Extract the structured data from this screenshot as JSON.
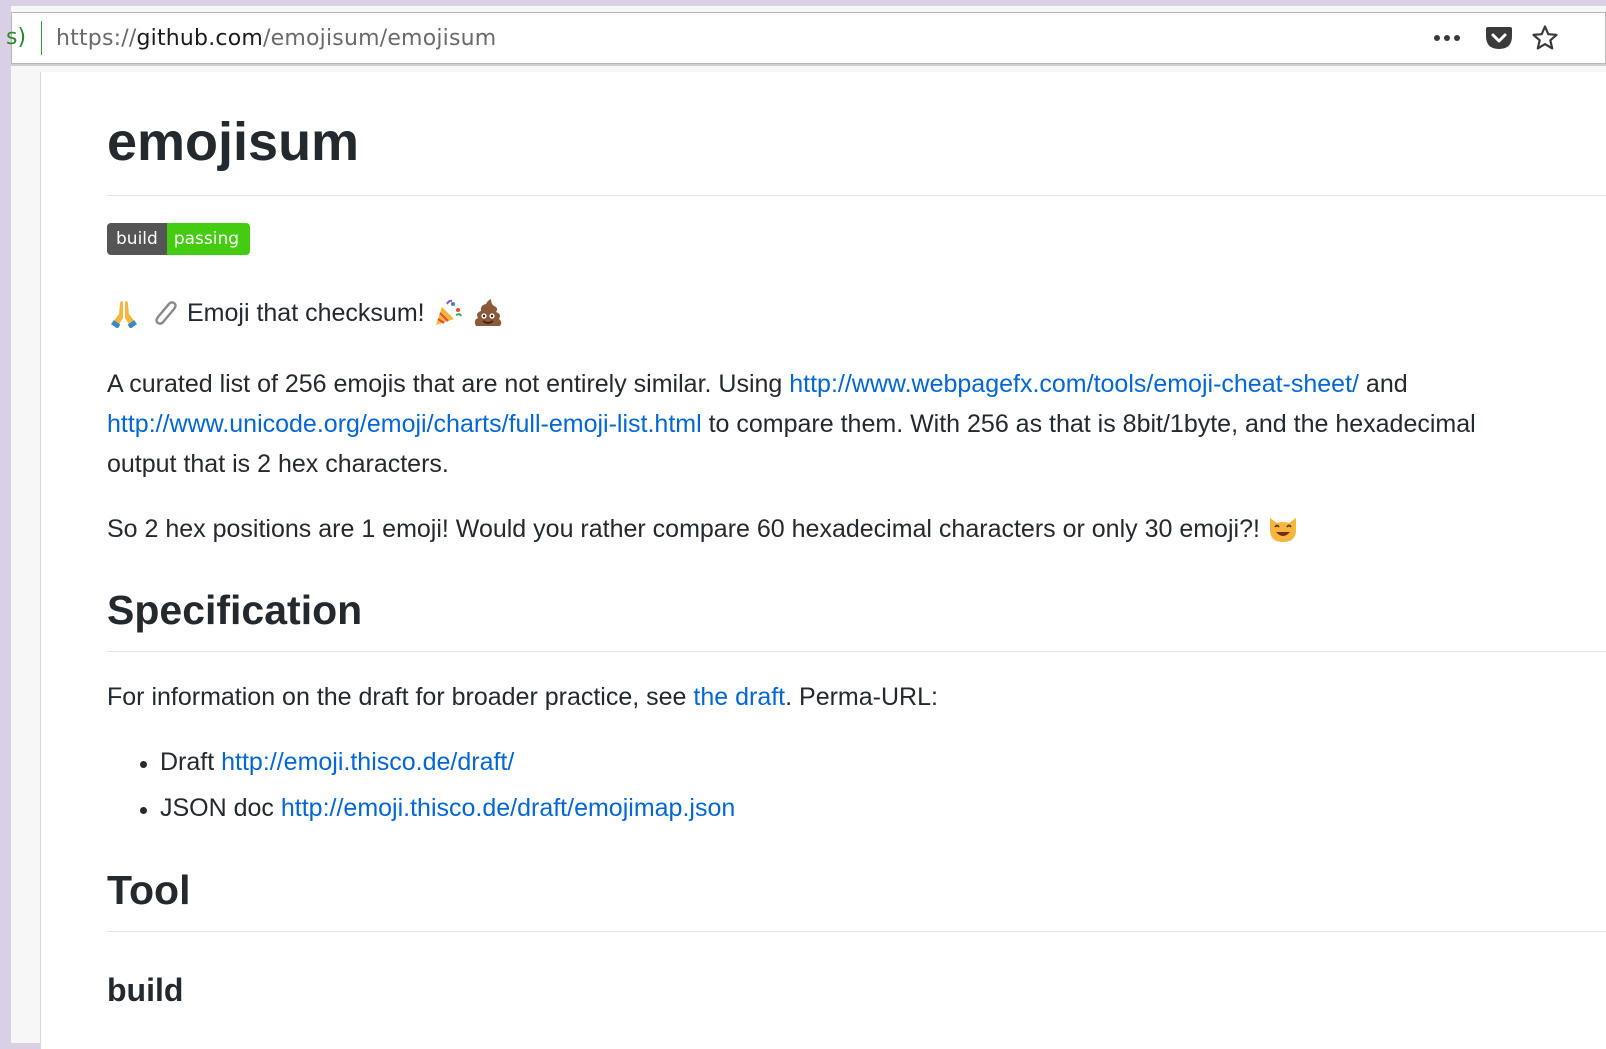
{
  "browser": {
    "url_lead": "s)",
    "url_scheme": "https://",
    "url_host": "github.com",
    "url_path": "/emojisum/emojisum"
  },
  "readme": {
    "title": "emojisum",
    "badge": {
      "label": "build",
      "status": "passing"
    },
    "tagline": "Emoji that checksum!",
    "intro": {
      "line1_pre": "A curated list of 256 emojis that are not entirely similar. Using ",
      "link1": "http://www.webpagefx.com/tools/emoji-cheat-sheet/",
      "line1_post": " and",
      "link2": "http://www.unicode.org/emoji/charts/full-emoji-list.html",
      "line2_post": " to compare them. With 256 as that is 8bit/1byte, and the hexadecimal",
      "line3": "output that is 2 hex characters."
    },
    "compare_text": "So 2 hex positions are 1 emoji! Would you rather compare 60 hexadecimal characters or only 30 emoji?!",
    "spec": {
      "heading": "Specification",
      "text_pre": "For information on the draft for broader practice, see ",
      "link": "the draft",
      "text_post": ". Perma-URL:",
      "items": [
        {
          "label": "Draft ",
          "link": "http://emoji.thisco.de/draft/"
        },
        {
          "label": "JSON doc ",
          "link": "http://emoji.thisco.de/draft/emojimap.json"
        }
      ]
    },
    "tool": {
      "heading": "Tool",
      "subheading": "build"
    }
  },
  "colors": {
    "link": "#0366d6",
    "text": "#24292e",
    "badge_label_bg": "#555555",
    "badge_status_bg": "#44cc11"
  },
  "icons": [
    "more-dots-icon",
    "pocket-icon",
    "star-icon",
    "folded-hands-icon",
    "paperclip-icon",
    "party-popper-icon",
    "poop-icon",
    "smiling-cat-icon"
  ]
}
